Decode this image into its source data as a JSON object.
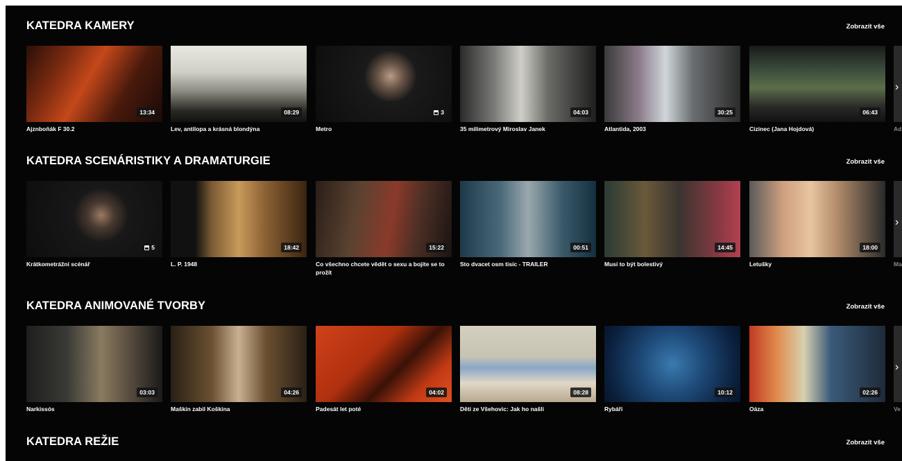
{
  "show_all_label": "Zobrazit vše",
  "sections": [
    {
      "title": "KATEDRA KAMERY",
      "items": [
        {
          "title": "Ajznboňák F 30.2",
          "badge": "13:34",
          "pack": false,
          "bg": "linear-gradient(120deg,#2a0f08 0%,#7a2a10 25%,#c4481a 45%,#4a1a0c 70%,#1a0a06 100%)"
        },
        {
          "title": "Lev, antilopa a krásná blondýna",
          "badge": "08:29",
          "pack": false,
          "bg": "linear-gradient(180deg,#e8e8e0 0%,#cfcfc6 35%,#8a8a80 60%,#2a2a24 85%,#111 100%)"
        },
        {
          "title": "Metro",
          "badge": "3",
          "pack": true,
          "bg": "radial-gradient(circle at 55% 40%,#b89c86 0%,#6b5648 14%,#1a1a1a 30%,#0c0c0c 100%)"
        },
        {
          "title": "35 milimetrový Miroslav Janek",
          "badge": "04:03",
          "pack": false,
          "bg": "linear-gradient(90deg,#2a2a2a 0%,#7a7a78 25%,#cfcfc8 45%,#6a6a66 65%,#1e1e1e 100%)"
        },
        {
          "title": "Atlantida, 2003",
          "badge": "30:25",
          "pack": false,
          "bg": "linear-gradient(90deg,#3a3a3a 0%,#8a7a88 25%,#cfd6da 45%,#6a6e70 65%,#2a2a2a 100%)"
        },
        {
          "title": "Cizinec (Jana Hojdová)",
          "badge": "06:43",
          "pack": false,
          "bg": "linear-gradient(180deg,#1a1a1a 0%,#3a4a3a 30%,#5b6e4a 55%,#2a2a28 80%,#111 100%)"
        }
      ],
      "partial": "Ad"
    },
    {
      "title": "KATEDRA SCENÁRISTIKY A DRAMATURGIE",
      "items": [
        {
          "title": "Krátkometrážní scénář",
          "badge": "5",
          "pack": true,
          "bg": "radial-gradient(circle at 55% 45%,#9a7a64 0%,#4a3a30 15%,#181818 32%,#0d0d0d 100%)"
        },
        {
          "title": "L. P. 1948",
          "badge": "18:42",
          "pack": false,
          "bg": "linear-gradient(90deg,#111 0%,#111 18%,#7a5a34 30%,#c89a5a 50%,#8a6034 70%,#3a2410 100%)"
        },
        {
          "title": "Co všechno chcete vědět o sexu a bojíte se to prožít",
          "badge": "15:22",
          "pack": false,
          "bg": "linear-gradient(100deg,#2a1e18 0%,#5a4230 30%,#8a3a2a 55%,#4a2e24 75%,#1a1412 100%)"
        },
        {
          "title": "Sto dvacet osm tisíc - TRAILER",
          "badge": "00:51",
          "pack": false,
          "bg": "linear-gradient(90deg,#1e3a4a 0%,#4a6a7a 30%,#9aa8ae 50%,#3a5a6a 75%,#14303e 100%)"
        },
        {
          "title": "Musí to být bolestivý",
          "badge": "14:45",
          "pack": false,
          "bg": "linear-gradient(90deg,#2a3a34 0%,#6a5a3a 30%,#3a3430 55%,#8a3a44 85%,#b44050 100%)"
        },
        {
          "title": "Letušky",
          "badge": "18:00",
          "pack": false,
          "bg": "linear-gradient(90deg,#5a5a5a 0%,#d0a080 25%,#e8c4a0 45%,#b08a6a 65%,#2a2a2a 100%)"
        }
      ],
      "partial": "Ma"
    },
    {
      "title": "KATEDRA ANIMOVANÉ TVORBY",
      "items": [
        {
          "title": "Narkissós",
          "badge": "03:03",
          "pack": false,
          "bg": "linear-gradient(90deg,#1e1e1e 0%,#3a3a36 30%,#8a7a60 55%,#5a4e40 75%,#1a1a1a 100%)"
        },
        {
          "title": "Maškin zabil Koškina",
          "badge": "04:26",
          "pack": false,
          "bg": "linear-gradient(90deg,#2a2016 0%,#6a5030 30%,#c8b090 50%,#6a5030 70%,#2a2016 100%)"
        },
        {
          "title": "Padesát let poté",
          "badge": "04:02",
          "pack": false,
          "bg": "linear-gradient(135deg,#d0421a 0%,#b0300e 40%,#3a1208 60%,#c23a14 80%,#e05020 100%)"
        },
        {
          "title": "Děti ze Všehovic: Jak ho našli",
          "badge": "08:28",
          "pack": false,
          "bg": "linear-gradient(180deg,#d4cfc0 0%,#c8c4b4 40%,#8aa6c8 55%,#e0d8c6 75%,#b8a890 100%)"
        },
        {
          "title": "Rybáři",
          "badge": "10:12",
          "pack": false,
          "bg": "radial-gradient(circle at 50% 50%,#3a7ab0 0%,#1e4a78 40%,#0c2240 80%,#06142a 100%)"
        },
        {
          "title": "Oáza",
          "badge": "02:26",
          "pack": false,
          "bg": "linear-gradient(90deg,#c03a24 0%,#e08a4a 20%,#d8d0b0 40%,#3a5a7a 60%,#1e2a3a 100%)"
        }
      ],
      "partial": "Ve"
    },
    {
      "title": "KATEDRA REŽIE",
      "items": [],
      "partial": ""
    }
  ],
  "arrow_glyph": "›"
}
